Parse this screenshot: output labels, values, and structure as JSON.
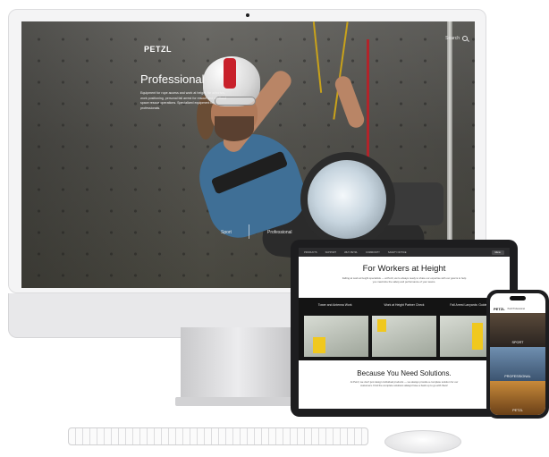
{
  "imac_site": {
    "logo": "PETZL",
    "search_label": "Search",
    "heading": "Professional",
    "description": "Equipment for rope access and work at height, for arborists, work positioning, personal fall arrest for rescue and confined space rescue operations. Specialized equipment for professionals.",
    "tabs": [
      "Sport",
      "Professional"
    ]
  },
  "ipad_site": {
    "nav_items": [
      "PRODUCTS",
      "SUPPORT",
      "WHY PETZL",
      "COMMUNITY",
      "SAFETY NOTICE"
    ],
    "nav_button": "Menu",
    "hero_title": "For Workers at Height",
    "hero_text": "Falling at work at height specialists — at Petzl, we're always ready to share our expertise with our goal is to help you maximize the safety and performance of your teams.",
    "columns": [
      "Tower and Antenna Work",
      "Work at Height Partner Check",
      "Fall Arrest Lanyards: Guided Lines"
    ],
    "footer_title": "Because You Need Solutions.",
    "footer_text": "At Petzl, we don't just design individual products — we always provide a complete solution for our customers. Find the complete solutions always have a back up to go with them!"
  },
  "iphone_site": {
    "logo": "PETZL",
    "header_text": "Petzl Professional",
    "tiles": [
      "SPORT",
      "PROFESSIONAL",
      "PETZL"
    ]
  },
  "colors": {
    "helmet_stripe": "#c8202a",
    "rope_gold": "#c9a21a",
    "shirt_blue": "#3f6f96",
    "accent_yellow": "#f0c81e"
  }
}
